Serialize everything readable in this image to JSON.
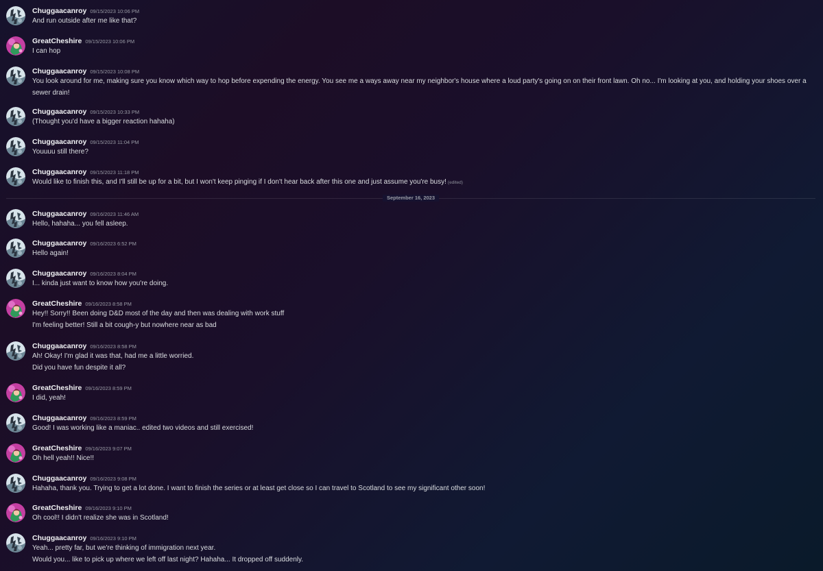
{
  "users": {
    "chugga": {
      "name": "Chuggaacanroy",
      "avatar_icon": "user-avatar-chuggaacanroy-icon"
    },
    "cheshire": {
      "name": "GreatCheshire",
      "avatar_icon": "user-avatar-greatcheshire-icon"
    }
  },
  "day_divider": {
    "label": "September 16, 2023"
  },
  "messages": [
    {
      "user": "Chuggaacanroy",
      "time": "09/15/2023 10:06 PM",
      "lines": [
        "And run outside after me like that?"
      ]
    },
    {
      "user": "GreatCheshire",
      "time": "09/15/2023 10:06 PM",
      "lines": [
        "I can hop"
      ]
    },
    {
      "user": "Chuggaacanroy",
      "time": "09/15/2023 10:08 PM",
      "lines": [
        "You look around for me, making sure you know which way to hop before expending the energy. You see me a ways away near my neighbor's house where a loud party's going on on their front lawn. Oh no... I'm looking at you, and holding your shoes over a",
        "sewer drain!"
      ]
    },
    {
      "user": "Chuggaacanroy",
      "time": "09/15/2023 10:33 PM",
      "lines": [
        "(Thought you'd have a bigger reaction hahaha)"
      ]
    },
    {
      "user": "Chuggaacanroy",
      "time": "09/15/2023 11:04 PM",
      "lines": [
        "Youuuu still there?"
      ]
    },
    {
      "user": "Chuggaacanroy",
      "time": "09/15/2023 11:18 PM",
      "lines": [
        "Would like to finish this, and I'll still be up for a bit, but I won't keep pinging if I don't hear back after this one and just assume you're busy!"
      ],
      "edited": "(edited)"
    },
    {
      "user": "Chuggaacanroy",
      "time": "09/16/2023 11:46 AM",
      "lines": [
        "Hello, hahaha... you fell asleep."
      ]
    },
    {
      "user": "Chuggaacanroy",
      "time": "09/16/2023 6:52 PM",
      "lines": [
        "Hello again!"
      ]
    },
    {
      "user": "Chuggaacanroy",
      "time": "09/16/2023 8:04 PM",
      "lines": [
        "I... kinda just want to know how you're doing."
      ]
    },
    {
      "user": "GreatCheshire",
      "time": "09/16/2023 8:58 PM",
      "lines": [
        "Hey!! Sorry!! Been doing D&D most of the day and then was dealing with work stuff",
        "I'm feeling better! Still a bit cough-y but nowhere near as bad"
      ]
    },
    {
      "user": "Chuggaacanroy",
      "time": "09/16/2023 8:58 PM",
      "lines": [
        "Ah! Okay! I'm glad it was that, had me a little worried.",
        "Did you have fun despite it all?"
      ]
    },
    {
      "user": "GreatCheshire",
      "time": "09/16/2023 8:59 PM",
      "lines": [
        "I did, yeah!"
      ]
    },
    {
      "user": "Chuggaacanroy",
      "time": "09/16/2023 8:59 PM",
      "lines": [
        "Good! I was working like a maniac.. edited two videos and still exercised!"
      ]
    },
    {
      "user": "GreatCheshire",
      "time": "09/16/2023 9:07 PM",
      "lines": [
        "Oh hell yeah!! Nice!!"
      ]
    },
    {
      "user": "Chuggaacanroy",
      "time": "09/16/2023 9:08 PM",
      "lines": [
        "Hahaha, thank you. Trying to get a lot done. I want to finish the series or at least get close so I can travel to Scotland to see my significant other soon!"
      ]
    },
    {
      "user": "GreatCheshire",
      "time": "09/16/2023 9:10 PM",
      "lines": [
        "Oh cool!! I didn't realize she was in Scotland!"
      ]
    },
    {
      "user": "Chuggaacanroy",
      "time": "09/16/2023 9:10 PM",
      "lines": [
        "Yeah... pretty far, but we're thinking of immigration next year.",
        "Would you... like to pick up where we left off last night? Hahaha... It dropped off suddenly."
      ]
    }
  ],
  "colors": {
    "username": "#f2f3f5",
    "timestamp": "#9a9ca6",
    "message_text": "#dbdee1",
    "divider_line": "rgba(255,255,255,0.10)"
  }
}
